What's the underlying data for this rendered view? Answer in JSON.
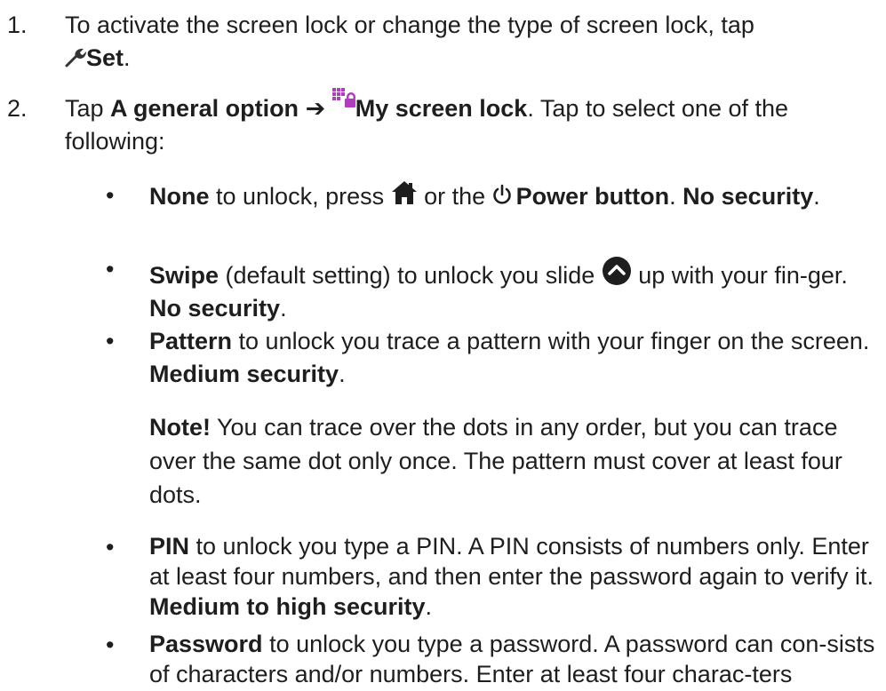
{
  "steps": [
    {
      "number": "1.",
      "text_before": "To activate the screen lock or change the type of screen lock, tap",
      "icon": "wrench-icon",
      "bold": "Set",
      "text_after": "."
    },
    {
      "number": "2.",
      "text_before": "Tap ",
      "bold_a": "A general option",
      "arrow": " ➔ ",
      "icon": "screen-lock-icon",
      "icon_color": "#b03cc0",
      "bold_b": "My screen lock",
      "text_after": ". Tap to select one of the following:"
    }
  ],
  "bullet_symbol": "•",
  "options": [
    {
      "bold": "None",
      "text_a": " to unlock, press ",
      "home_icon": "home-icon",
      "text_b": " or the ",
      "power_icon": "power-icon",
      "bold_power": "Power button",
      "text_c": ". ",
      "security": "No security",
      "end": "."
    },
    {
      "bold": "Swipe",
      "text_a": " (default setting) to unlock you slide ",
      "icon": "swipe-up-icon",
      "text_b": " up with your fin-ger. ",
      "security": "No security",
      "end": "."
    },
    {
      "bold": "Pattern",
      "text_a": " to unlock you trace a pattern with your finger on the screen. ",
      "security": "Medium security",
      "end": "."
    },
    {
      "bold": "PIN",
      "text_a": " to unlock you type a PIN. A PIN consists of numbers only. Enter at least four numbers, and then enter the password again to verify it. ",
      "security": "Medium to high security",
      "end": "."
    },
    {
      "bold": "Password",
      "text_a": " to unlock you type a password. A password can con-sists of characters and/or numbers. Enter at least four charac-ters including numbers and symbols, and then enter the"
    }
  ],
  "note": {
    "bold": "Note!",
    "text": " You can trace over the dots in any order, but you can trace over the same dot only once. The pattern must cover at least four dots."
  }
}
